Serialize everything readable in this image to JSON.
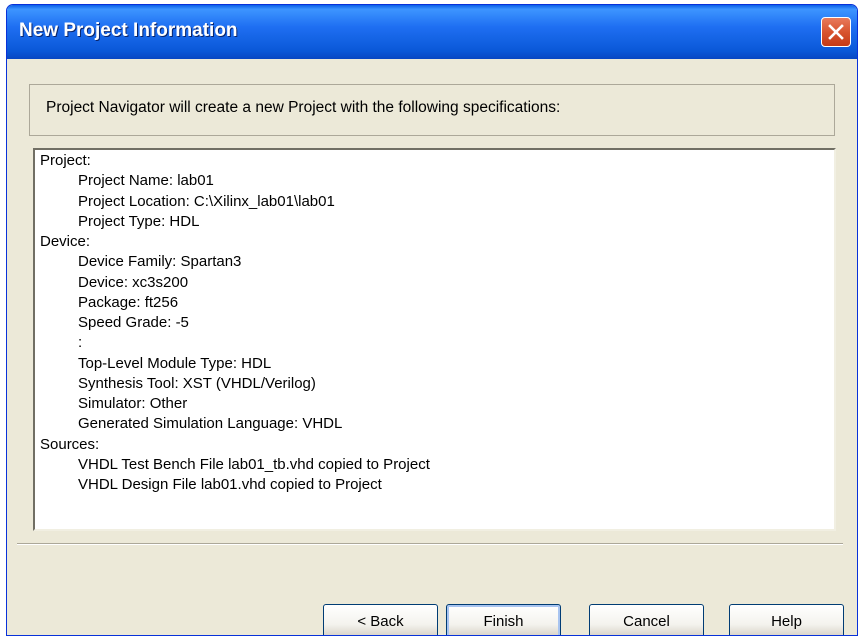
{
  "window": {
    "title": "New Project Information"
  },
  "info": {
    "text": "Project Navigator will create a new Project with the following specifications:"
  },
  "summary": {
    "sections": [
      {
        "heading": "Project:",
        "lines": [
          "Project Name: lab01",
          "Project Location: C:\\Xilinx_lab01\\lab01",
          "Project Type: HDL"
        ]
      },
      {
        "heading": "Device:",
        "lines": [
          "Device Family: Spartan3",
          "Device: xc3s200",
          "Package: ft256",
          "Speed Grade: -5",
          ":",
          "Top-Level Module Type: HDL",
          "Synthesis Tool: XST (VHDL/Verilog)",
          "Simulator: Other",
          "Generated Simulation Language: VHDL"
        ]
      },
      {
        "heading": "Sources:",
        "lines": [
          "VHDL Test Bench File lab01_tb.vhd copied to Project",
          "VHDL Design File lab01.vhd copied to Project"
        ]
      }
    ]
  },
  "buttons": {
    "back": "< Back",
    "finish": "Finish",
    "cancel": "Cancel",
    "help": "Help"
  },
  "icons": {
    "close": "close-icon"
  }
}
